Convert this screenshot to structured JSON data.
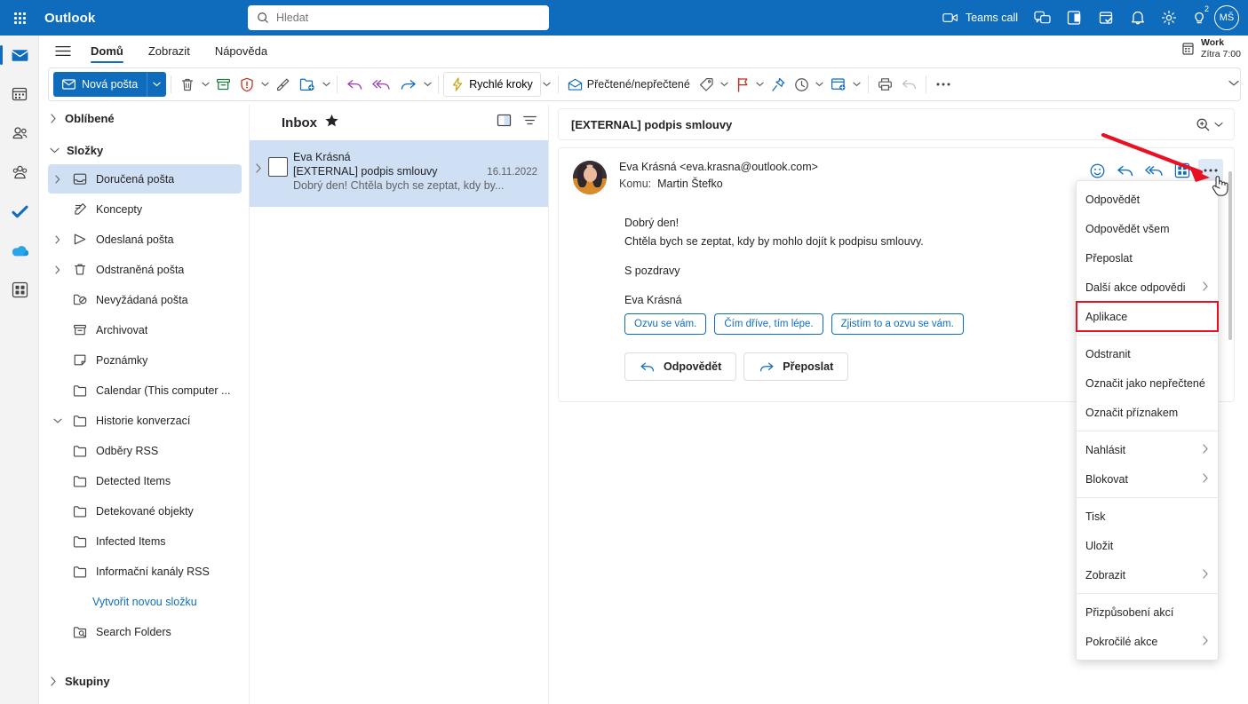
{
  "topbar": {
    "waffle_label": "app-launcher",
    "brand": "Outlook",
    "search": {
      "placeholder": "Hledat",
      "value": ""
    },
    "teams_call": "Teams call",
    "notifications_badge": "2",
    "avatar_initials": "MŠ",
    "icons": [
      "video-camera-icon",
      "chat-icon",
      "onenote-icon",
      "tasks-icon",
      "bell-icon",
      "gear-icon",
      "lightbulb-icon"
    ],
    "accent_color": "#0F6CBD"
  },
  "rail": {
    "items": [
      {
        "name": "mail",
        "icon": "mail-icon",
        "active": true
      },
      {
        "name": "calendar",
        "icon": "calendar-icon",
        "active": false
      },
      {
        "name": "people",
        "icon": "people-icon",
        "active": false
      },
      {
        "name": "groups",
        "icon": "groups-icon",
        "active": false
      },
      {
        "name": "todo",
        "icon": "checkmark-icon",
        "active": false
      },
      {
        "name": "onedrive",
        "icon": "cloud-icon",
        "active": false
      },
      {
        "name": "more-apps",
        "icon": "apps-grid-icon",
        "active": false
      }
    ]
  },
  "ribbon": {
    "tabs": [
      {
        "label": "Domů",
        "active": true
      },
      {
        "label": "Zobrazit",
        "active": false
      },
      {
        "label": "Nápověda",
        "active": false
      }
    ],
    "next_event": {
      "title": "Work",
      "time": "Zítra 7:00"
    },
    "new_mail": "Nová pošta",
    "quick_steps": "Rychlé kroky",
    "read_unread": "Přečtené/nepřečtené",
    "tool_icons": [
      "delete-icon",
      "archive-icon",
      "report-icon",
      "sweep-icon",
      "move-to-icon",
      "reply-icon",
      "reply-all-icon",
      "forward-icon"
    ],
    "right_icons": [
      "tag-icon",
      "flag-icon",
      "pin-icon",
      "snooze-icon",
      "rules-icon",
      "print-icon",
      "undo-icon",
      "more-icon"
    ]
  },
  "folders": {
    "favorites_label": "Oblíbené",
    "folders_label": "Složky",
    "groups_label": "Skupiny",
    "items": [
      {
        "label": "Doručená pošta",
        "icon": "inbox-icon",
        "chevron": true,
        "selected": true,
        "indent": 0
      },
      {
        "label": "Koncepty",
        "icon": "drafts-icon",
        "chevron": false,
        "selected": false,
        "indent": 0
      },
      {
        "label": "Odeslaná pošta",
        "icon": "sent-icon",
        "chevron": true,
        "selected": false,
        "indent": 0
      },
      {
        "label": "Odstraněná pošta",
        "icon": "trash-icon",
        "chevron": true,
        "selected": false,
        "indent": 0
      },
      {
        "label": "Nevyžádaná pošta",
        "icon": "junk-icon",
        "chevron": false,
        "selected": false,
        "indent": 0
      },
      {
        "label": "Archivovat",
        "icon": "archive-icon",
        "chevron": false,
        "selected": false,
        "indent": 0
      },
      {
        "label": "Poznámky",
        "icon": "notes-icon",
        "chevron": false,
        "selected": false,
        "indent": 0
      },
      {
        "label": "Calendar (This computer ...",
        "icon": "folder-icon",
        "chevron": false,
        "selected": false,
        "indent": 0
      },
      {
        "label": "Historie konverzací",
        "icon": "folder-icon",
        "chevron": true,
        "expanded": true,
        "selected": false,
        "indent": 0
      },
      {
        "label": "Odběry RSS",
        "icon": "folder-icon",
        "chevron": false,
        "selected": false,
        "indent": 1
      },
      {
        "label": "Detected Items",
        "icon": "folder-icon",
        "chevron": false,
        "selected": false,
        "indent": 0
      },
      {
        "label": "Detekované objekty",
        "icon": "folder-icon",
        "chevron": false,
        "selected": false,
        "indent": 0
      },
      {
        "label": "Infected Items",
        "icon": "folder-icon",
        "chevron": false,
        "selected": false,
        "indent": 0
      },
      {
        "label": "Informační kanály RSS",
        "icon": "folder-icon",
        "chevron": false,
        "selected": false,
        "indent": 0
      }
    ],
    "create_folder_link": "Vytvořit novou složku",
    "search_folders": "Search Folders"
  },
  "msglist": {
    "title": "Inbox",
    "pinned_icon": "star-icon",
    "header_icons": [
      "reading-pane-icon",
      "filter-icon"
    ],
    "rows": [
      {
        "from": "Eva Krásná",
        "subject": "[EXTERNAL] podpis smlouvy",
        "date": "16.11.2022",
        "preview": "Dobrý den! Chtěla bych se zeptat, kdy by...",
        "selected": true
      }
    ]
  },
  "reading": {
    "subject": "[EXTERNAL] podpis smlouvy",
    "zoom_icon": "zoom-in-icon",
    "sender": "Eva Krásná <eva.krasna@outlook.com>",
    "to_label": "Komu:",
    "to_value": "Martin Štefko",
    "action_icons": [
      "emoji-icon",
      "reply-icon",
      "reply-all-icon",
      "apps-grid-icon",
      "more-actions-icon"
    ],
    "body_lines": [
      "Dobrý den!",
      "Chtěla bych se zeptat, kdy by mohlo dojít k podpisu smlouvy."
    ],
    "closing": "S pozdravy",
    "signature": "Eva Krásná",
    "suggested_replies": [
      "Ozvu se vám.",
      "Čím dříve, tím lépe.",
      "Zjistím to a ozvu se vám."
    ],
    "buttons": [
      {
        "label": "Odpovědět",
        "icon": "reply-icon"
      },
      {
        "label": "Přeposlat",
        "icon": "forward-icon"
      }
    ]
  },
  "context_menu": {
    "highlight_color": "#e81123",
    "items": [
      {
        "label": "Odpovědět",
        "submenu": false,
        "highlighted": false,
        "separator_after": false
      },
      {
        "label": "Odpovědět všem",
        "submenu": false,
        "highlighted": false,
        "separator_after": false
      },
      {
        "label": "Přeposlat",
        "submenu": false,
        "highlighted": false,
        "separator_after": false
      },
      {
        "label": "Další akce odpovědi",
        "submenu": true,
        "highlighted": false,
        "separator_after": false
      },
      {
        "label": "Aplikace",
        "submenu": false,
        "highlighted": true,
        "separator_after": true
      },
      {
        "label": "Odstranit",
        "submenu": false,
        "highlighted": false,
        "separator_after": false
      },
      {
        "label": "Označit jako nepřečtené",
        "submenu": false,
        "highlighted": false,
        "separator_after": false
      },
      {
        "label": "Označit příznakem",
        "submenu": false,
        "highlighted": false,
        "separator_after": true
      },
      {
        "label": "Nahlásit",
        "submenu": true,
        "highlighted": false,
        "separator_after": false
      },
      {
        "label": "Blokovat",
        "submenu": true,
        "highlighted": false,
        "separator_after": true
      },
      {
        "label": "Tisk",
        "submenu": false,
        "highlighted": false,
        "separator_after": false
      },
      {
        "label": "Uložit",
        "submenu": false,
        "highlighted": false,
        "separator_after": false
      },
      {
        "label": "Zobrazit",
        "submenu": true,
        "highlighted": false,
        "separator_after": true
      },
      {
        "label": "Přizpůsobení akcí",
        "submenu": false,
        "highlighted": false,
        "separator_after": false
      },
      {
        "label": "Pokročilé akce",
        "submenu": true,
        "highlighted": false,
        "separator_after": false
      }
    ]
  },
  "annotation": {
    "arrow_color": "#e81123",
    "arrow_name": "red-pointer-arrow"
  }
}
